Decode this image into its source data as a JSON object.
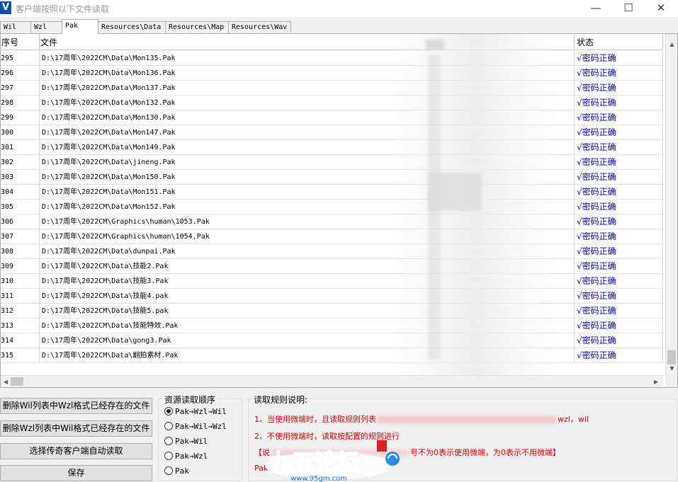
{
  "window": {
    "title": "客户端按照以下文件读取",
    "icon_letter": "V",
    "controls": {
      "minimize": "—",
      "maximize": "☐",
      "close": "✕"
    }
  },
  "tabs": [
    {
      "label": "Wil",
      "active": false
    },
    {
      "label": "Wzl",
      "active": false
    },
    {
      "label": "Pak",
      "active": true
    },
    {
      "label": "Resources\\Data",
      "active": false
    },
    {
      "label": "Resources\\Map",
      "active": false
    },
    {
      "label": "Resources\\Wav",
      "active": false
    }
  ],
  "grid": {
    "columns": {
      "index": "序号",
      "file": "文件",
      "status": "状态"
    },
    "rows": [
      {
        "index": "295",
        "file": "D:\\17周年\\2022CM\\Data\\Mon135.Pak",
        "status": "√密码正确"
      },
      {
        "index": "296",
        "file": "D:\\17周年\\2022CM\\Data\\Mon136.Pak",
        "status": "√密码正确"
      },
      {
        "index": "297",
        "file": "D:\\17周年\\2022CM\\Data\\Mon137.Pak",
        "status": "√密码正确"
      },
      {
        "index": "298",
        "file": "D:\\17周年\\2022CM\\Data\\Mon132.Pak",
        "status": "√密码正确"
      },
      {
        "index": "299",
        "file": "D:\\17周年\\2022CM\\Data\\Mon130.Pak",
        "status": "√密码正确"
      },
      {
        "index": "300",
        "file": "D:\\17周年\\2022CM\\Data\\Mon147.Pak",
        "status": "√密码正确"
      },
      {
        "index": "301",
        "file": "D:\\17周年\\2022CM\\Data\\Mon149.Pak",
        "status": "√密码正确"
      },
      {
        "index": "302",
        "file": "D:\\17周年\\2022CM\\Data\\jineng.Pak",
        "status": "√密码正确"
      },
      {
        "index": "303",
        "file": "D:\\17周年\\2022CM\\Data\\Mon150.Pak",
        "status": "√密码正确"
      },
      {
        "index": "304",
        "file": "D:\\17周年\\2022CM\\Data\\Mon151.Pak",
        "status": "√密码正确"
      },
      {
        "index": "305",
        "file": "D:\\17周年\\2022CM\\Data\\Mon152.Pak",
        "status": "√密码正确"
      },
      {
        "index": "306",
        "file": "D:\\17周年\\2022CM\\Graphics\\human\\1053.Pak",
        "status": "√密码正确"
      },
      {
        "index": "307",
        "file": "D:\\17周年\\2022CM\\Graphics\\human\\1054.Pak",
        "status": "√密码正确"
      },
      {
        "index": "308",
        "file": "D:\\17周年\\2022CM\\Data\\dunpai.Pak",
        "status": "√密码正确"
      },
      {
        "index": "309",
        "file": "D:\\17周年\\2022CM\\Data\\技能2.Pak",
        "status": "√密码正确"
      },
      {
        "index": "310",
        "file": "D:\\17周年\\2022CM\\Data\\技能3.Pak",
        "status": "√密码正确"
      },
      {
        "index": "311",
        "file": "D:\\17周年\\2022CM\\Data\\技能4.pak",
        "status": "√密码正确"
      },
      {
        "index": "312",
        "file": "D:\\17周年\\2022CM\\Data\\技能5.pak",
        "status": "√密码正确"
      },
      {
        "index": "313",
        "file": "D:\\17周年\\2022CM\\Data\\技能特效.Pak",
        "status": "√密码正确"
      },
      {
        "index": "314",
        "file": "D:\\17周年\\2022CM\\Data\\gong3.Pak",
        "status": "√密码正确"
      },
      {
        "index": "315",
        "file": "D:\\17周年\\2022CM\\Data\\翻拍素材.Pak",
        "status": "√密码正确"
      }
    ]
  },
  "buttons": {
    "delete_wil": "删除Wil列表中Wzl格式已经存在的文件",
    "delete_wzl": "删除Wzl列表中Wil格式已经存在的文件",
    "auto_read": "选择传奇客户端自动读取",
    "save": "保存"
  },
  "order_group": {
    "title": "资源读取顺序",
    "options": [
      {
        "label": "Pak→Wzl→Wil",
        "checked": true
      },
      {
        "label": "Pak→Wil→Wzl",
        "checked": false
      },
      {
        "label": "Pak→Wil",
        "checked": false
      },
      {
        "label": "Pak→Wzl",
        "checked": false
      },
      {
        "label": "Pak",
        "checked": false
      }
    ]
  },
  "rules_group": {
    "title": "读取规则说明:",
    "line1_start": "1、当使用微端时，且读取规则列表",
    "line1_end": "wzl，wil",
    "line2": "2、不使用微端时，读取按配置的规则进行",
    "line3_start": "【说",
    "line3_end": "号不为0表示使用微端，为0表示不用微端】",
    "line4": "Pak"
  },
  "watermark": {
    "text": "九五论坛",
    "url": "www.95gm.com"
  },
  "colors": {
    "status_blue": "#0000c8",
    "rule_red": "#e00000",
    "brand_blue": "#0a4fa8"
  }
}
